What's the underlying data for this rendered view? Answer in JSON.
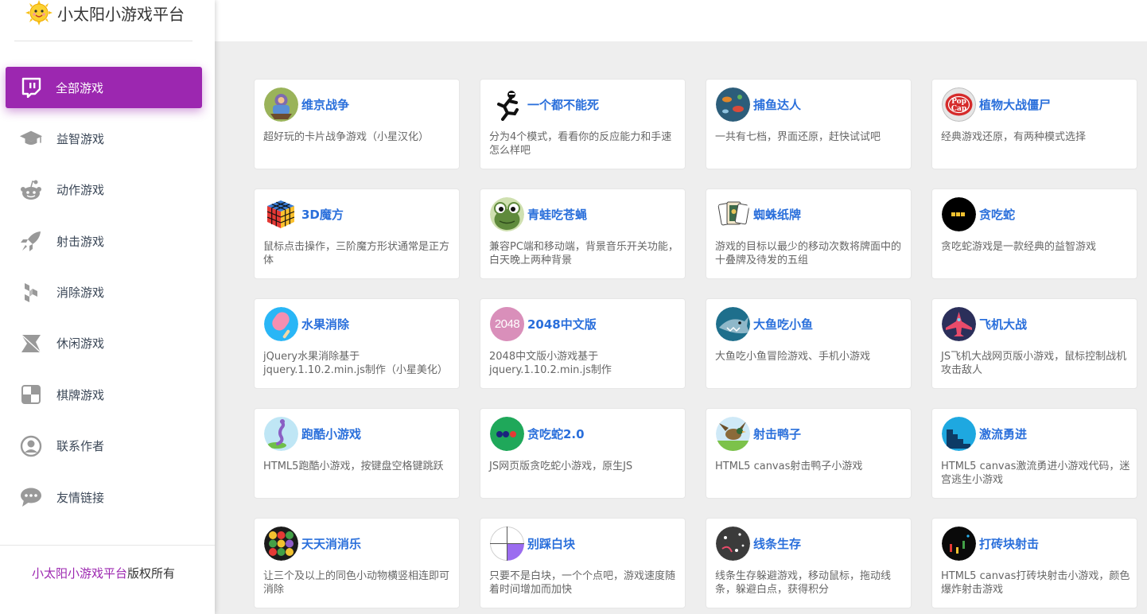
{
  "brand": {
    "title": "小太阳小游戏平台"
  },
  "nav": [
    {
      "label": "全部游戏",
      "icon": "twitch-icon",
      "active": true
    },
    {
      "label": "益智游戏",
      "icon": "graduation-cap-icon"
    },
    {
      "label": "动作游戏",
      "icon": "reddit-icon"
    },
    {
      "label": "射击游戏",
      "icon": "rocket-icon"
    },
    {
      "label": "消除游戏",
      "icon": "hubspot-icon"
    },
    {
      "label": "休闲游戏",
      "icon": "envira-icon"
    },
    {
      "label": "棋牌游戏",
      "icon": "chessboard-icon"
    },
    {
      "label": "联系作者",
      "icon": "user-circle-icon"
    },
    {
      "label": "友情链接",
      "icon": "comment-icon"
    }
  ],
  "footer": {
    "link": "小太阳小游戏平台",
    "suffix": "版权所有"
  },
  "colors": {
    "accent": "#9c27b0",
    "title": "#2a6fdb"
  },
  "games": [
    {
      "title": "维京战争",
      "desc": "超好玩的卡片战争游戏（小星汉化）",
      "icon": "viking-war-icon"
    },
    {
      "title": "一个都不能死",
      "desc": "分为4个模式，看看你的反应能力和手速怎么样吧",
      "icon": "running-man-icon"
    },
    {
      "title": "捕鱼达人",
      "desc": "一共有七档，界面还原，赶快试试吧",
      "icon": "fishing-icon"
    },
    {
      "title": "植物大战僵尸",
      "desc": "经典游戏还原，有两种模式选择",
      "icon": "popcap-icon"
    },
    {
      "title": "3D魔方",
      "desc": "鼠标点击操作，三阶魔方形状通常是正方体",
      "icon": "rubiks-cube-icon"
    },
    {
      "title": "青蛙吃苍蝇",
      "desc": "兼容PC端和移动端，背景音乐开关功能，白天晚上两种背景",
      "icon": "frog-icon"
    },
    {
      "title": "蜘蛛纸牌",
      "desc": "游戏的目标以最少的移动次数将牌面中的十叠牌及待发的五组",
      "icon": "playing-cards-icon"
    },
    {
      "title": "贪吃蛇",
      "desc": "贪吃蛇游戏是一款经典的益智游戏",
      "icon": "snake-icon"
    },
    {
      "title": "水果消除",
      "desc": "jQuery水果消除基于jquery.1.10.2.min.js制作（小星美化）",
      "icon": "popsicle-icon"
    },
    {
      "title": "2048中文版",
      "desc": "2048中文版小游戏基于jquery.1.10.2.min.js制作",
      "icon": "2048-icon",
      "icon_text": "2048"
    },
    {
      "title": "大鱼吃小鱼",
      "desc": "大鱼吃小鱼冒险游戏、手机小游戏",
      "icon": "shark-icon"
    },
    {
      "title": "飞机大战",
      "desc": "JS飞机大战网页版小游戏，鼠标控制战机攻击敌人",
      "icon": "fighter-plane-icon"
    },
    {
      "title": "跑酷小游戏",
      "desc": "HTML5跑酷小游戏，按键盘空格键跳跃",
      "icon": "parkour-icon"
    },
    {
      "title": "贪吃蛇2.0",
      "desc": "JS网页版贪吃蛇小游戏，原生JS",
      "icon": "snake-dots-icon"
    },
    {
      "title": "射击鸭子",
      "desc": "HTML5 canvas射击鸭子小游戏",
      "icon": "duck-icon"
    },
    {
      "title": "激流勇进",
      "desc": "HTML5 canvas激流勇进小游戏代码，迷宫逃生小游戏",
      "icon": "stairs-icon"
    },
    {
      "title": "天天消消乐",
      "desc": "让三个及以上的同色小动物横竖相连即可消除",
      "icon": "animals-icon"
    },
    {
      "title": "别踩白块",
      "desc": "只要不是白块，一个个点吧，游戏速度随着时间增加而加快",
      "icon": "tiles-icon"
    },
    {
      "title": "线条生存",
      "desc": "线条生存躲避游戏，移动鼠标，拖动线条，躲避白点，获得积分",
      "icon": "line-survive-icon"
    },
    {
      "title": "打砖块射击",
      "desc": "HTML5 canvas打砖块射击小游戏，颜色爆炸射击游戏",
      "icon": "brick-shooter-icon"
    }
  ]
}
